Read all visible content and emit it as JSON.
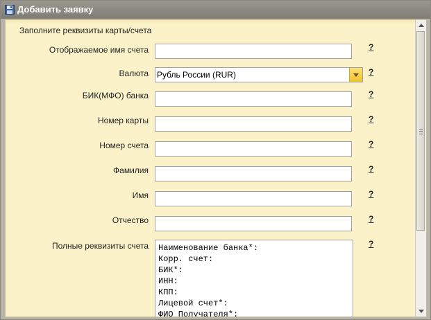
{
  "window": {
    "title": "Добавить заявку",
    "icon": "floppy-disk-icon"
  },
  "form": {
    "heading": "Заполните реквизиты карты/счета",
    "help_symbol": "?",
    "fields": {
      "display_name": {
        "label": "Отображаемое имя счета",
        "value": ""
      },
      "currency": {
        "label": "Валюта",
        "value": "Рубль России (RUR)"
      },
      "bik": {
        "label": "БИК(МФО) банка",
        "value": ""
      },
      "card_number": {
        "label": "Номер карты",
        "value": ""
      },
      "account_number": {
        "label": "Номер счета",
        "value": ""
      },
      "last_name": {
        "label": "Фамилия",
        "value": ""
      },
      "first_name": {
        "label": "Имя",
        "value": ""
      },
      "patronymic": {
        "label": "Отчество",
        "value": ""
      },
      "full_details": {
        "label": "Полные реквизиты счета",
        "value": "Наименование банка*:\nКорр. счет:\nБИК*:\nИНН:\nКПП:\nЛицевой счет*:\nФИО Получателя*:"
      }
    }
  },
  "colors": {
    "panel_bg": "#fbf2c9",
    "accent": "#f2c22e"
  }
}
